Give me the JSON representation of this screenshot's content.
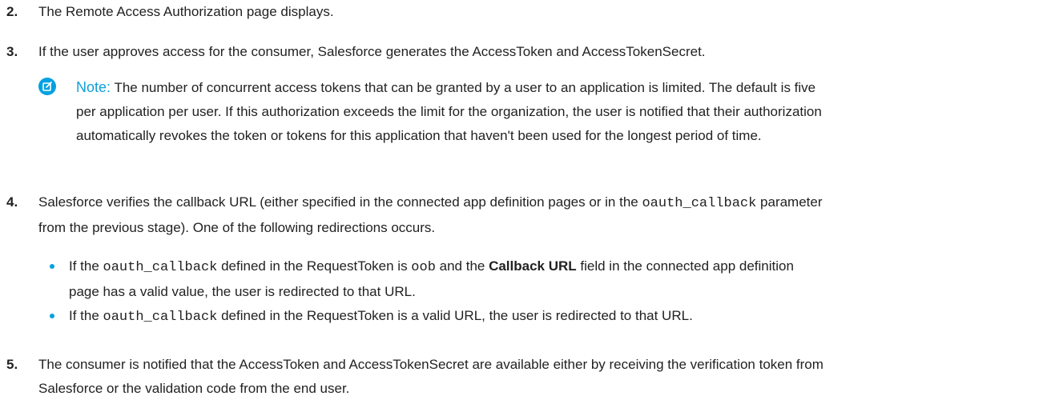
{
  "steps": [
    {
      "number": "2.",
      "text": "The Remote Access Authorization page displays."
    },
    {
      "number": "3.",
      "text": "If the user approves access for the consumer, Salesforce generates the AccessToken and AccessTokenSecret."
    },
    {
      "number": "4.",
      "line1_a": "Salesforce verifies the callback URL (either specified in the connected app definition pages or in the ",
      "line1_code": "oauth_callback",
      "line1_b": " parameter",
      "line2": "from the previous stage). One of the following redirections occurs."
    },
    {
      "number": "5.",
      "line1": "The consumer is notified that the AccessToken and AccessTokenSecret are available either by receiving the verification token from",
      "line2": "Salesforce or the validation code from the end user."
    }
  ],
  "note": {
    "label": "Note:",
    "line1": " The number of concurrent access tokens that can be granted by a user to an application is limited. The default is five",
    "line2": "per application per user. If this authorization exceeds the limit for the organization, the user is notified that their authorization",
    "line3": "automatically revokes the token or tokens for this application that haven't been used for the longest period of time."
  },
  "bullets": [
    {
      "a": "If the ",
      "code1": "oauth_callback",
      "b": " defined in the RequestToken is ",
      "code2": "oob",
      "c": " and the ",
      "bold": "Callback URL",
      "d": " field in the connected app definition",
      "line2": "page has a valid value, the user is redirected to that URL."
    },
    {
      "a": "If the ",
      "code1": "oauth_callback",
      "b": " defined in the RequestToken is a valid URL, the user is redirected to that URL."
    }
  ],
  "colors": {
    "accent": "#00a1e0",
    "note_label": "#0e9fd8",
    "text": "#222222"
  },
  "icons": {
    "note": "edit-note-icon"
  }
}
